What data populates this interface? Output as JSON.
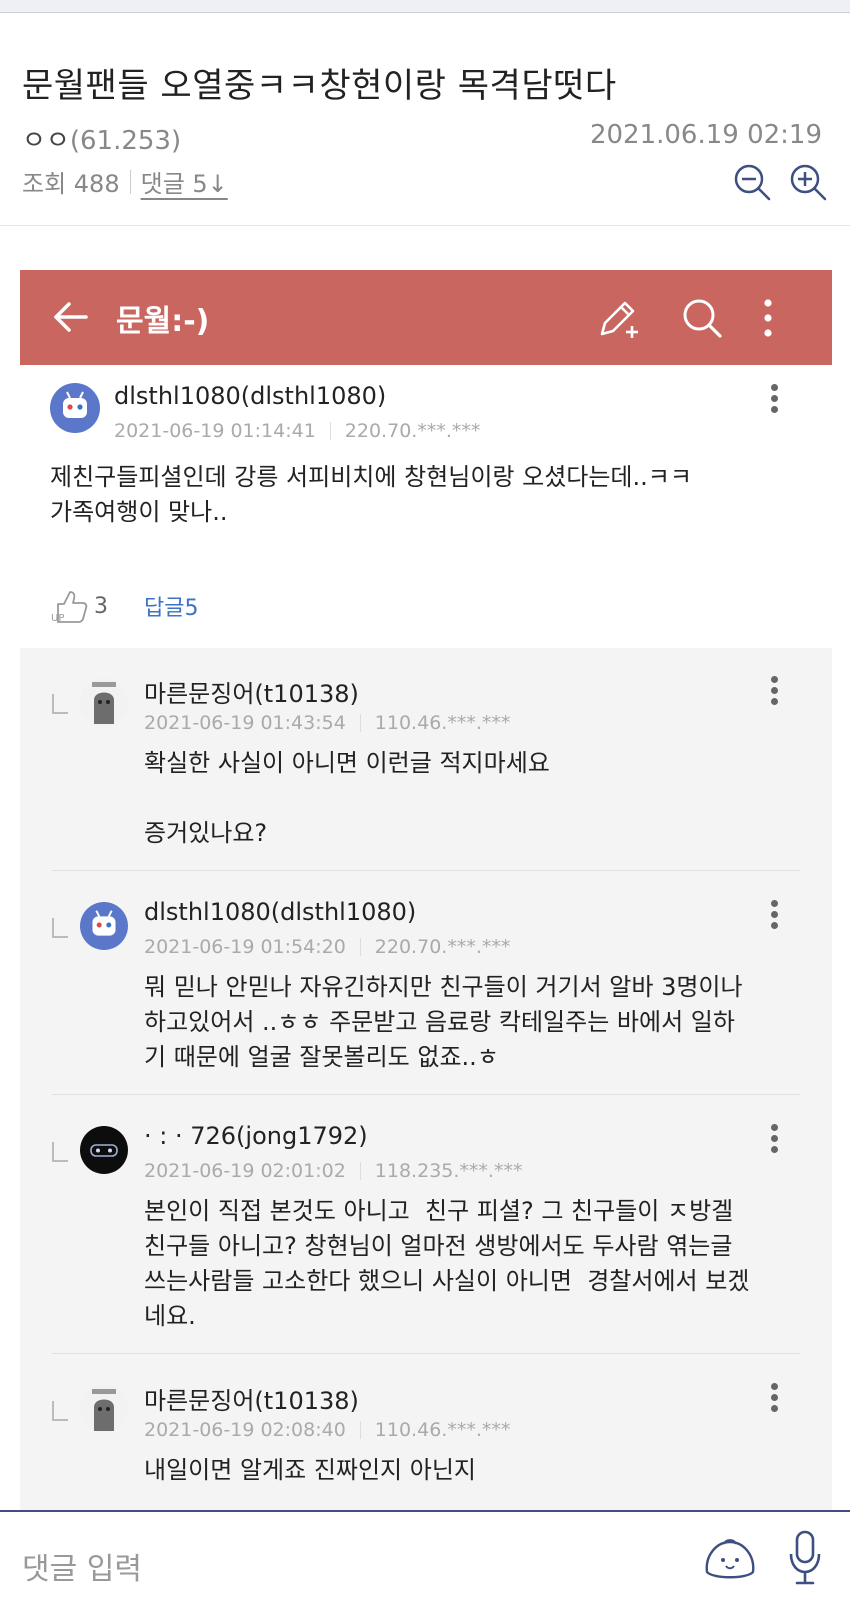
{
  "post": {
    "title": "문월팬들 오열중ㅋㅋ창현이랑 목격담떳다",
    "author": "ㅇㅇ",
    "author_ip": "(61.253)",
    "date": "2021.06.19 02:19",
    "views": "조회 488",
    "comments_link": "댓글 5↓"
  },
  "screenshot": {
    "appbar": {
      "title": "문월:-)",
      "color": "#ca6660",
      "icons": [
        "back-arrow-icon",
        "pencil-add-icon",
        "search-icon",
        "more-vertical-icon"
      ]
    },
    "main_comment": {
      "name": "dlsthl1080(dlsthl1080)",
      "date": "2021-06-19 01:14:41",
      "ip": "220.70.***.***",
      "text": "제친구들피셜인데 강릉 서피비치에 창현님이랑 오셨다는데..ㅋㅋ\n가족여행이 맞나..",
      "likes": "3",
      "reply_label": "답글5"
    },
    "replies": [
      {
        "name": "마른문징어(t10138)",
        "date": "2021-06-19 01:43:54",
        "ip": "110.46.***.***",
        "text": "확실한 사실이 아니면 이런글 적지마세요\n\n증거있나요?"
      },
      {
        "name": "dlsthl1080(dlsthl1080)",
        "date": "2021-06-19 01:54:20",
        "ip": "220.70.***.***",
        "text": "뭐 믿나 안믿나 자유긴하지만 친구들이 거기서 알바 3명이나\n하고있어서 ..ㅎㅎ 주문받고 음료랑 칵테일주는 바에서 일하\n기 때문에 얼굴 잘못볼리도 없죠..ㅎ"
      },
      {
        "name": "· : · 726(jong1792)",
        "date": "2021-06-19 02:01:02",
        "ip": "118.235.***.***",
        "text": "본인이 직접 본것도 아니고  친구 피셜? 그 친구들이 ㅈ방겔\n친구들 아니고? 창현님이 얼마전 생방에서도 두사람 엮는글\n쓰는사람들 고소한다 했으니 사실이 아니면  경찰서에서 보겠\n네요."
      },
      {
        "name": "마른문징어(t10138)",
        "date": "2021-06-19 02:08:40",
        "ip": "110.46.***.***",
        "text": "내일이면 알게죠 진짜인지 아닌지"
      }
    ]
  },
  "input": {
    "placeholder": "댓글 입력"
  }
}
